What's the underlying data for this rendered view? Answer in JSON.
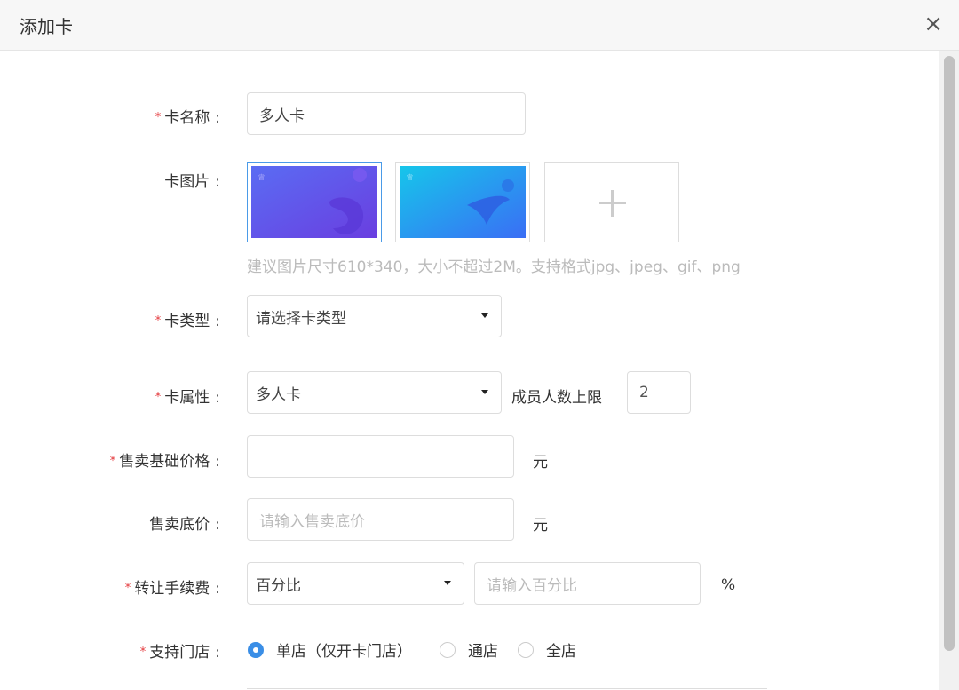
{
  "dialog": {
    "title": "添加卡",
    "close_icon": "×"
  },
  "form": {
    "card_name": {
      "label": "卡名称",
      "required": true,
      "value": "多人卡"
    },
    "card_image": {
      "label": "卡图片",
      "hint": "建议图片尺寸610*340，大小不超过2M。支持格式jpg、jpeg、gif、png",
      "options": [
        {
          "style": "purple-blue",
          "selected": true
        },
        {
          "style": "cyan-blue",
          "selected": false
        }
      ],
      "add_icon": "plus-icon"
    },
    "card_type": {
      "label": "卡类型",
      "required": true,
      "placeholder": "请选择卡类型"
    },
    "card_attr": {
      "label": "卡属性",
      "required": true,
      "value": "多人卡",
      "member_limit_label": "成员人数上限",
      "member_limit_value": "2"
    },
    "base_price": {
      "label": "售卖基础价格",
      "required": true,
      "value": "",
      "unit": "元"
    },
    "floor_price": {
      "label": "售卖底价",
      "required": false,
      "placeholder": "请输入售卖底价",
      "unit": "元"
    },
    "transfer_fee": {
      "label": "转让手续费",
      "required": true,
      "mode": "百分比",
      "placeholder": "请输入百分比",
      "unit": "%"
    },
    "stores": {
      "label": "支持门店",
      "required": true,
      "options": [
        {
          "label": "单店（仅开卡门店）",
          "checked": true
        },
        {
          "label": "通店",
          "checked": false
        },
        {
          "label": "全店",
          "checked": false
        }
      ]
    }
  },
  "colors": {
    "accent": "#3a8ee6",
    "required_star": "#e4393c",
    "placeholder": "#bbbbbb"
  }
}
